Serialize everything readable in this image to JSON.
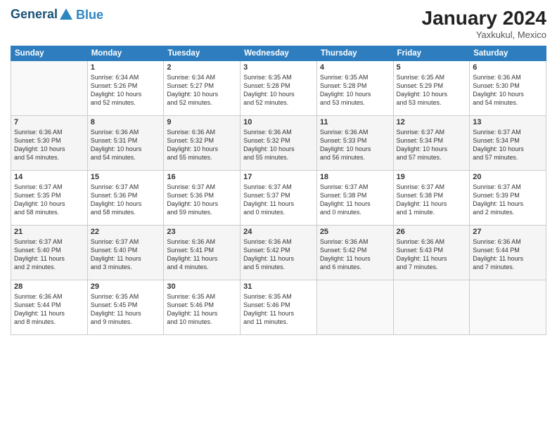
{
  "header": {
    "logo_line1": "General",
    "logo_line2": "Blue",
    "month_year": "January 2024",
    "location": "Yaxkukul, Mexico"
  },
  "weekdays": [
    "Sunday",
    "Monday",
    "Tuesday",
    "Wednesday",
    "Thursday",
    "Friday",
    "Saturday"
  ],
  "weeks": [
    [
      {
        "day": "",
        "info": ""
      },
      {
        "day": "1",
        "info": "Sunrise: 6:34 AM\nSunset: 5:26 PM\nDaylight: 10 hours\nand 52 minutes."
      },
      {
        "day": "2",
        "info": "Sunrise: 6:34 AM\nSunset: 5:27 PM\nDaylight: 10 hours\nand 52 minutes."
      },
      {
        "day": "3",
        "info": "Sunrise: 6:35 AM\nSunset: 5:28 PM\nDaylight: 10 hours\nand 52 minutes."
      },
      {
        "day": "4",
        "info": "Sunrise: 6:35 AM\nSunset: 5:28 PM\nDaylight: 10 hours\nand 53 minutes."
      },
      {
        "day": "5",
        "info": "Sunrise: 6:35 AM\nSunset: 5:29 PM\nDaylight: 10 hours\nand 53 minutes."
      },
      {
        "day": "6",
        "info": "Sunrise: 6:36 AM\nSunset: 5:30 PM\nDaylight: 10 hours\nand 54 minutes."
      }
    ],
    [
      {
        "day": "7",
        "info": "Sunrise: 6:36 AM\nSunset: 5:30 PM\nDaylight: 10 hours\nand 54 minutes."
      },
      {
        "day": "8",
        "info": "Sunrise: 6:36 AM\nSunset: 5:31 PM\nDaylight: 10 hours\nand 54 minutes."
      },
      {
        "day": "9",
        "info": "Sunrise: 6:36 AM\nSunset: 5:32 PM\nDaylight: 10 hours\nand 55 minutes."
      },
      {
        "day": "10",
        "info": "Sunrise: 6:36 AM\nSunset: 5:32 PM\nDaylight: 10 hours\nand 55 minutes."
      },
      {
        "day": "11",
        "info": "Sunrise: 6:36 AM\nSunset: 5:33 PM\nDaylight: 10 hours\nand 56 minutes."
      },
      {
        "day": "12",
        "info": "Sunrise: 6:37 AM\nSunset: 5:34 PM\nDaylight: 10 hours\nand 57 minutes."
      },
      {
        "day": "13",
        "info": "Sunrise: 6:37 AM\nSunset: 5:34 PM\nDaylight: 10 hours\nand 57 minutes."
      }
    ],
    [
      {
        "day": "14",
        "info": "Sunrise: 6:37 AM\nSunset: 5:35 PM\nDaylight: 10 hours\nand 58 minutes."
      },
      {
        "day": "15",
        "info": "Sunrise: 6:37 AM\nSunset: 5:36 PM\nDaylight: 10 hours\nand 58 minutes."
      },
      {
        "day": "16",
        "info": "Sunrise: 6:37 AM\nSunset: 5:36 PM\nDaylight: 10 hours\nand 59 minutes."
      },
      {
        "day": "17",
        "info": "Sunrise: 6:37 AM\nSunset: 5:37 PM\nDaylight: 11 hours\nand 0 minutes."
      },
      {
        "day": "18",
        "info": "Sunrise: 6:37 AM\nSunset: 5:38 PM\nDaylight: 11 hours\nand 0 minutes."
      },
      {
        "day": "19",
        "info": "Sunrise: 6:37 AM\nSunset: 5:38 PM\nDaylight: 11 hours\nand 1 minute."
      },
      {
        "day": "20",
        "info": "Sunrise: 6:37 AM\nSunset: 5:39 PM\nDaylight: 11 hours\nand 2 minutes."
      }
    ],
    [
      {
        "day": "21",
        "info": "Sunrise: 6:37 AM\nSunset: 5:40 PM\nDaylight: 11 hours\nand 2 minutes."
      },
      {
        "day": "22",
        "info": "Sunrise: 6:37 AM\nSunset: 5:40 PM\nDaylight: 11 hours\nand 3 minutes."
      },
      {
        "day": "23",
        "info": "Sunrise: 6:36 AM\nSunset: 5:41 PM\nDaylight: 11 hours\nand 4 minutes."
      },
      {
        "day": "24",
        "info": "Sunrise: 6:36 AM\nSunset: 5:42 PM\nDaylight: 11 hours\nand 5 minutes."
      },
      {
        "day": "25",
        "info": "Sunrise: 6:36 AM\nSunset: 5:42 PM\nDaylight: 11 hours\nand 6 minutes."
      },
      {
        "day": "26",
        "info": "Sunrise: 6:36 AM\nSunset: 5:43 PM\nDaylight: 11 hours\nand 7 minutes."
      },
      {
        "day": "27",
        "info": "Sunrise: 6:36 AM\nSunset: 5:44 PM\nDaylight: 11 hours\nand 7 minutes."
      }
    ],
    [
      {
        "day": "28",
        "info": "Sunrise: 6:36 AM\nSunset: 5:44 PM\nDaylight: 11 hours\nand 8 minutes."
      },
      {
        "day": "29",
        "info": "Sunrise: 6:35 AM\nSunset: 5:45 PM\nDaylight: 11 hours\nand 9 minutes."
      },
      {
        "day": "30",
        "info": "Sunrise: 6:35 AM\nSunset: 5:46 PM\nDaylight: 11 hours\nand 10 minutes."
      },
      {
        "day": "31",
        "info": "Sunrise: 6:35 AM\nSunset: 5:46 PM\nDaylight: 11 hours\nand 11 minutes."
      },
      {
        "day": "",
        "info": ""
      },
      {
        "day": "",
        "info": ""
      },
      {
        "day": "",
        "info": ""
      }
    ]
  ]
}
